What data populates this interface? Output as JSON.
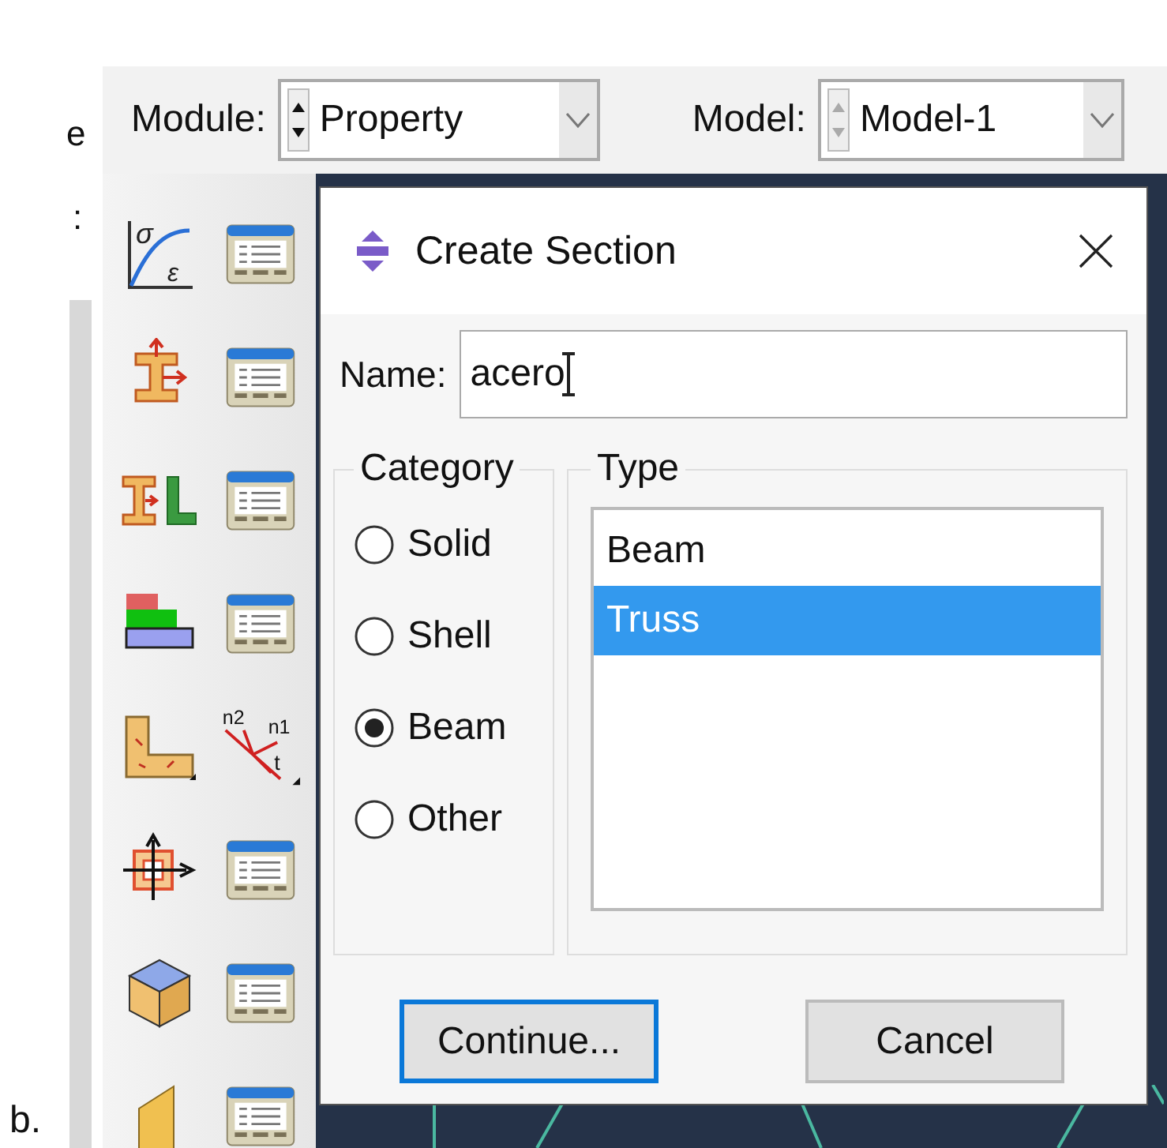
{
  "left_edge": {
    "texts": [
      "e",
      ":"
    ]
  },
  "top_bar": {
    "combos": [
      {
        "label": "Module:",
        "value": "Property"
      },
      {
        "label": "Model:",
        "value": "Model-1"
      }
    ]
  },
  "toolbar": [
    {
      "kind": "curve",
      "labels": [
        "σ",
        "ε"
      ]
    },
    {
      "kind": "manager"
    },
    {
      "kind": "beam"
    },
    {
      "kind": "manager"
    },
    {
      "kind": "beam-l"
    },
    {
      "kind": "manager"
    },
    {
      "kind": "layers"
    },
    {
      "kind": "manager"
    },
    {
      "kind": "l-shape"
    },
    {
      "kind": "axes",
      "labels": [
        "n2",
        "n1",
        "t"
      ]
    },
    {
      "kind": "crosshair"
    },
    {
      "kind": "manager"
    },
    {
      "kind": "cube"
    },
    {
      "kind": "manager"
    },
    {
      "kind": "sheet"
    },
    {
      "kind": "manager"
    }
  ],
  "dialog": {
    "title": "Create Section",
    "name_label": "Name:",
    "name_value": "acero",
    "category": {
      "title": "Category",
      "options": [
        {
          "label": "Solid",
          "selected": false
        },
        {
          "label": "Shell",
          "selected": false
        },
        {
          "label": "Beam",
          "selected": true
        },
        {
          "label": "Other",
          "selected": false
        }
      ]
    },
    "type": {
      "title": "Type",
      "items": [
        {
          "label": "Beam",
          "selected": false
        },
        {
          "label": "Truss",
          "selected": true
        }
      ]
    },
    "buttons": [
      {
        "label": "Continue...",
        "focused": true
      },
      {
        "label": "Cancel",
        "focused": false
      }
    ]
  },
  "caption": "b."
}
